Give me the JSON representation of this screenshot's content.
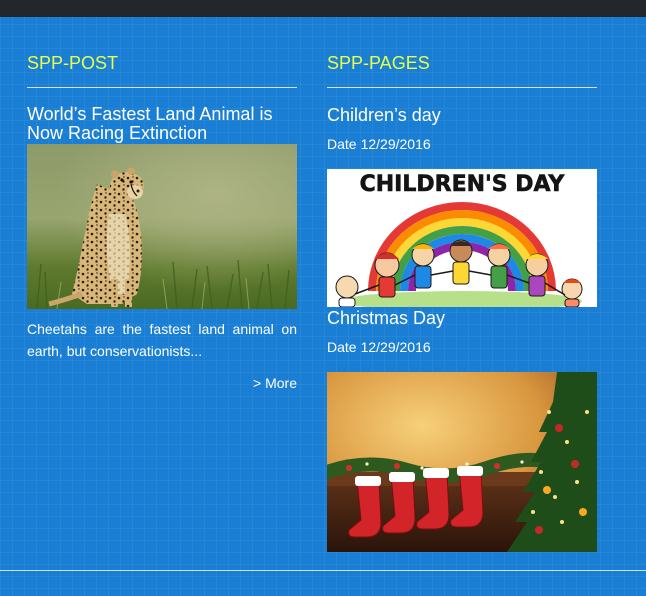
{
  "left_widget": {
    "title": "SPP-POST",
    "post": {
      "title": "World’s Fastest Land Animal is Now Racing Extinction",
      "image_alt": "cheetah-photo",
      "excerpt": "Cheetahs are the fastest land animal on earth, but conservationists...",
      "more_label": "> More"
    }
  },
  "right_widget": {
    "title": "SPP-PAGES",
    "pages": [
      {
        "title": "Children’s day",
        "date_label": "Date",
        "date": "12/29/2016",
        "banner_text": "CHILDREN'S DAY"
      },
      {
        "title": "Christmas Day",
        "date_label": "Date",
        "date": "12/29/2016"
      }
    ]
  },
  "colors": {
    "background": "#1a7fd4",
    "top_bar": "#23272b",
    "widget_title": "#e5ff4a",
    "text": "#ffffff"
  }
}
